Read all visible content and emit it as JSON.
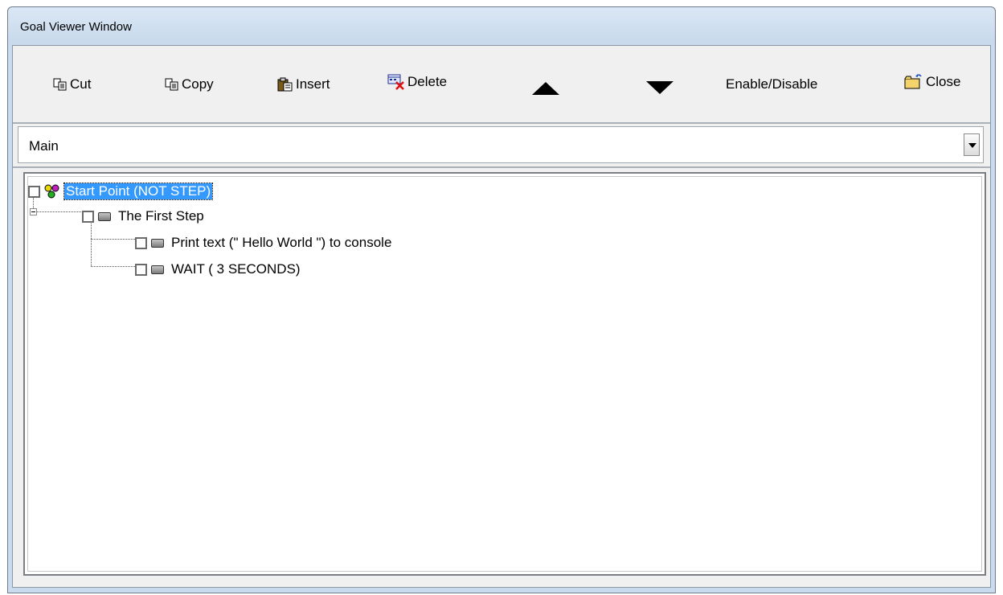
{
  "window": {
    "title": "Goal Viewer Window"
  },
  "toolbar": {
    "cut_label": "Cut",
    "copy_label": "Copy",
    "insert_label": "Insert",
    "delete_label": "Delete",
    "move_up_icon": "triangle-up-icon",
    "move_down_icon": "triangle-down-icon",
    "enable_disable_label": "Enable/Disable",
    "close_label": "Close"
  },
  "goal_selector": {
    "selected": "Main"
  },
  "tree": {
    "nodes": [
      {
        "label": "Start Point (NOT STEP)",
        "selected": true
      },
      {
        "label": "The First Step",
        "expanded": true
      },
      {
        "label": "Print text (\" Hello World \") to console"
      },
      {
        "label": "WAIT ( 3 SECONDS)"
      }
    ]
  },
  "colors": {
    "selection": "#3399ff",
    "titlebar": "#c9dbec"
  }
}
